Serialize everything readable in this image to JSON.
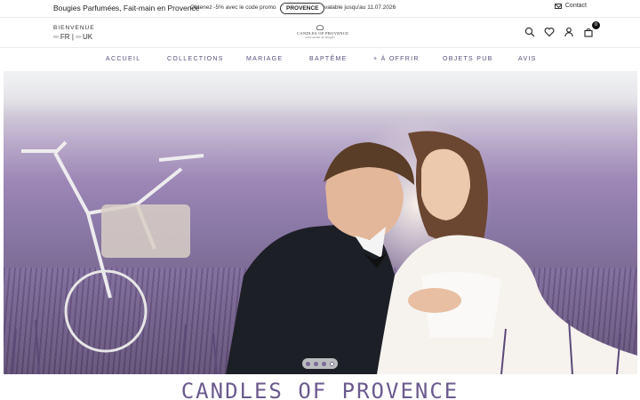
{
  "topbar": {
    "tagline": "Bougies Parfumées, Fait-main en Provence",
    "promo_text": "Obtenez -5% avec le code promo",
    "promo_code": "PROVENCE",
    "validity": "valable jusqu'au 11.07.2026",
    "contact_label": "Contact",
    "contact_icon": "mail-icon"
  },
  "header": {
    "welcome": "BIENVENUE",
    "lang_fr": "FR",
    "lang_sep": "|",
    "lang_uk": "UK",
    "logo_text": "CANDLES OF PROVENCE",
    "logo_subtitle": "notre atelier de bougies",
    "icons": [
      "search-icon",
      "heart-icon",
      "user-icon",
      "cart-icon"
    ],
    "cart_count": "0"
  },
  "nav": {
    "items": [
      {
        "label": "ACCUEIL"
      },
      {
        "label": "COLLECTIONS"
      },
      {
        "label": "MARIAGE"
      },
      {
        "label": "BAPTÊME"
      },
      {
        "label": "+ À OFFRIR"
      },
      {
        "label": "OBJETS PUB"
      },
      {
        "label": "AVIS"
      }
    ]
  },
  "hero": {
    "slides": 4,
    "active_slide": 4,
    "accent_color": "#7a6a9a"
  },
  "brand_title": "CANDLES OF PROVENCE",
  "colors": {
    "nav_text": "#5b4f7f",
    "title": "#6b5a8e",
    "lavender": "#8a78a6"
  }
}
